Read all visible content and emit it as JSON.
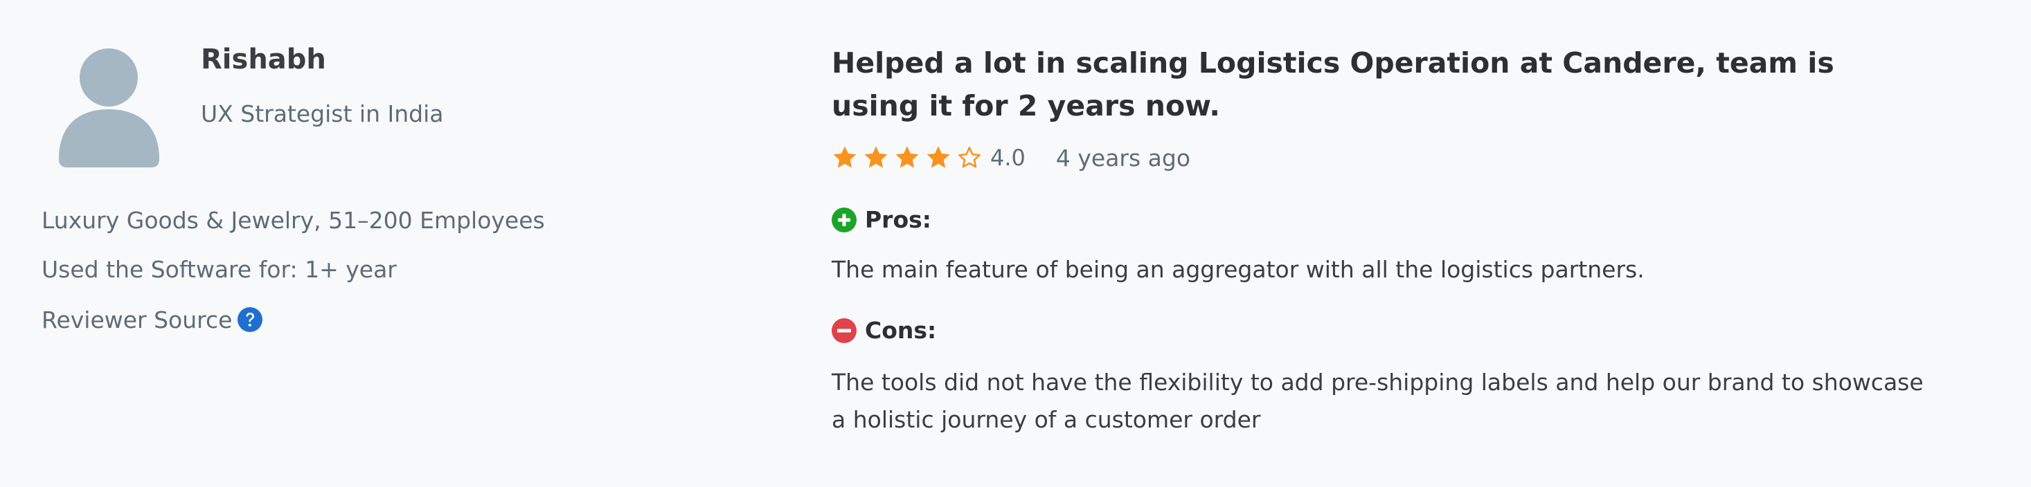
{
  "reviewer": {
    "name": "Rishabh",
    "role": "UX Strategist in India",
    "industry": "Luxury Goods & Jewelry, 51–200 Employees",
    "used_software": "Used the Software for: 1+ year",
    "source_label": "Reviewer Source",
    "avatar_icon": "user-silhouette-icon",
    "help_icon": "question-circle-icon"
  },
  "review": {
    "title": "Helped a lot in scaling Logistics Operation at Candere, team is using it for 2 years now.",
    "rating": 4.0,
    "rating_text": "4.0",
    "rating_max": 5,
    "time_ago": "4 years ago",
    "pros_label": "Pros:",
    "pros_text": "The main feature of being an aggregator with all the logistics partners.",
    "cons_label": "Cons:",
    "cons_text": "The tools did not have the flexibility to add pre-shipping labels and help our brand to showcase a holistic journey of a customer order"
  },
  "colors": {
    "background": "#f7f9fa",
    "star": "#f7931e",
    "pros_icon": "#1aa52a",
    "cons_icon": "#e0424b",
    "help_icon": "#1f6fd1",
    "avatar": "#a4b7c3"
  }
}
